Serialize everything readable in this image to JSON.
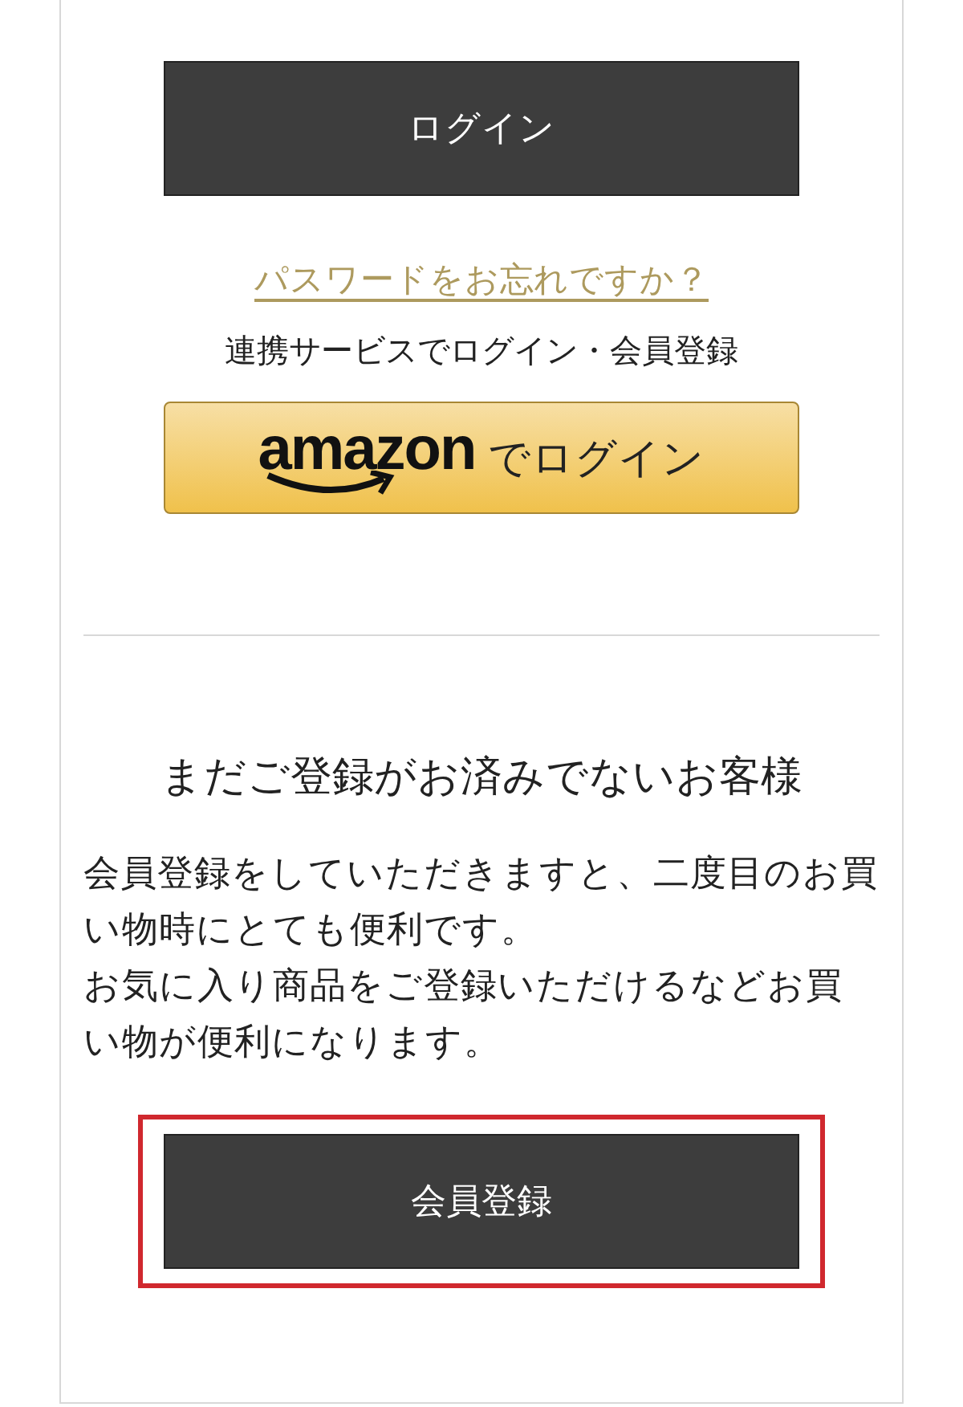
{
  "login_button": "ログイン",
  "forgot_password_link": "パスワードをお忘れですか？",
  "social_login": {
    "caption": "連携サービスでログイン・会員登録",
    "amazon_button": {
      "brand": "amazon",
      "label": "でログイン"
    }
  },
  "new_customer": {
    "heading": "まだご登録がお済みでないお客様",
    "paragraphs": [
      "会員登録をしていただきますと、二度目のお買い物時にとても便利です。",
      "お気に入り商品をご登録いただけるなどお買い物が便利になります。"
    ],
    "register_button": {
      "label": "会員登録",
      "highlighted": true
    }
  }
}
